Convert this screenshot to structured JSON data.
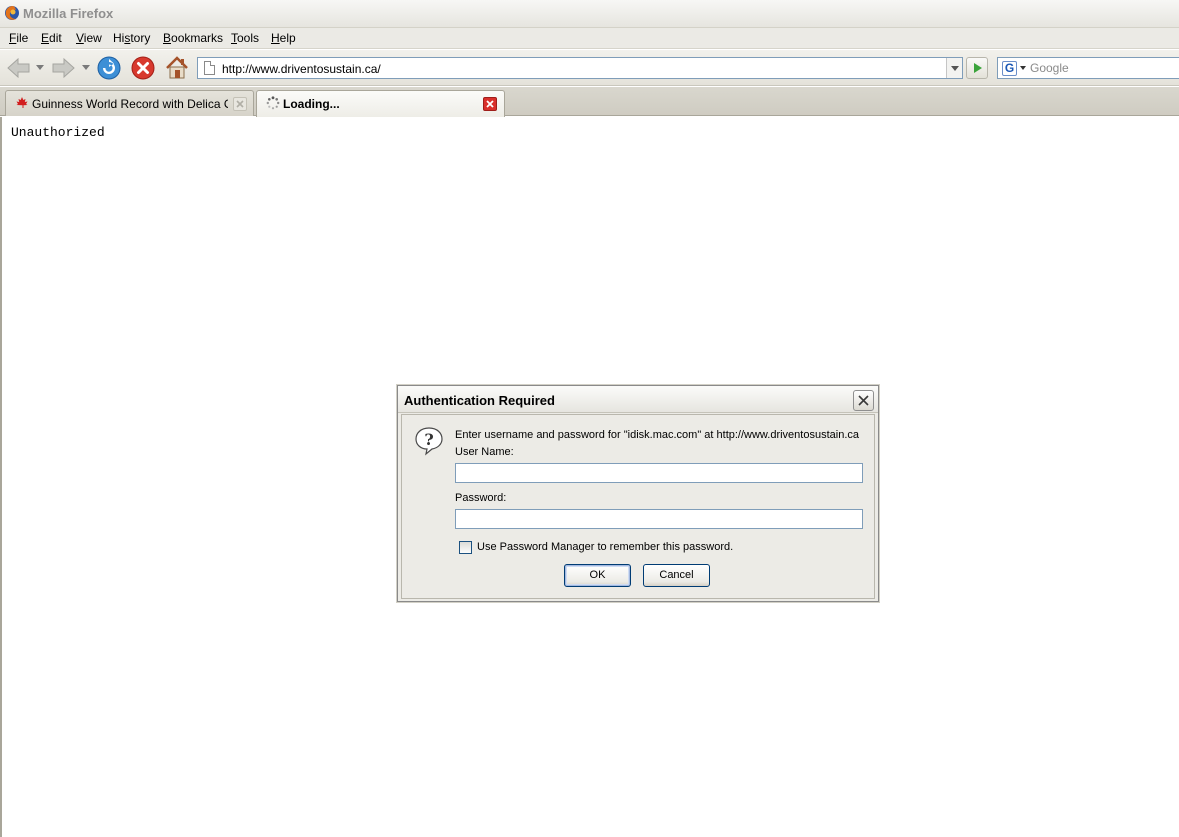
{
  "window": {
    "title": "Mozilla Firefox"
  },
  "menu": {
    "items": [
      {
        "label": "File",
        "accel": "F",
        "rest": "ile"
      },
      {
        "label": "Edit",
        "accel": "E",
        "rest": "dit"
      },
      {
        "label": "View",
        "accel": "V",
        "rest": "iew"
      },
      {
        "label": "History",
        "pre": "Hi",
        "accel": "s",
        "rest": "tory"
      },
      {
        "label": "Bookmarks",
        "accel": "B",
        "rest": "ookmarks"
      },
      {
        "label": "Tools",
        "accel": "T",
        "rest": "ools"
      },
      {
        "label": "Help",
        "accel": "H",
        "rest": "elp"
      }
    ]
  },
  "navbar": {
    "url": "http://www.driventosustain.ca/",
    "search_placeholder": "Google"
  },
  "tabs": [
    {
      "label": "Guinness World Record with Delica Oc...",
      "active": false
    },
    {
      "label": "Loading...",
      "active": true
    }
  ],
  "content": {
    "text": "Unauthorized"
  },
  "dialog": {
    "title": "Authentication Required",
    "message": "Enter username and password for \"idisk.mac.com\" at http://www.driventosustain.ca",
    "username_label": "User Name:",
    "username_value": "",
    "password_label": "Password:",
    "password_value": "",
    "remember_label": "Use Password Manager to remember this password.",
    "remember_checked": false,
    "ok_label": "OK",
    "cancel_label": "Cancel"
  },
  "colors": {
    "close_red": "#d9302b",
    "go_green": "#3aa33a",
    "field_border": "#7f9db9"
  }
}
